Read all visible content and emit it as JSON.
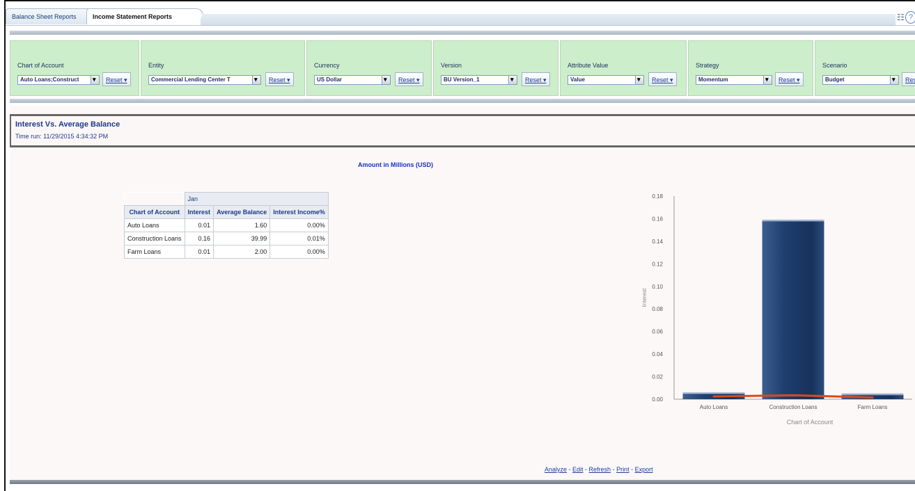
{
  "tabs": [
    {
      "label": "Balance Sheet Reports",
      "active": false
    },
    {
      "label": "Income Statement Reports",
      "active": true
    }
  ],
  "prompts": [
    {
      "label": "Chart of Account",
      "value": "Auto Loans;Construct",
      "reset": "Reset ▾"
    },
    {
      "label": "Entity",
      "value": "Commercial Lending Center T",
      "reset": "Reset ▾"
    },
    {
      "label": "Currency",
      "value": "US Dollar",
      "reset": "Reset ▾"
    },
    {
      "label": "Version",
      "value": "BU Version_1",
      "reset": "Reset ▾"
    },
    {
      "label": "Attribute Value",
      "value": "Value",
      "reset": "Reset ▾"
    },
    {
      "label": "Strategy",
      "value": "Momentum",
      "reset": "Reset ▾"
    },
    {
      "label": "Scenario",
      "value": "Budget",
      "reset": "Res"
    }
  ],
  "report": {
    "title": "Interest Vs. Average Balance",
    "time_run": "Time run: 11/29/2015 4:34:32 PM",
    "units": "Amount in Millions (USD)"
  },
  "table": {
    "period": "Jan",
    "headers": [
      "Chart of Account",
      "Interest",
      "Average Balance",
      "Interest Income%"
    ],
    "rows": [
      [
        "Auto Loans",
        "0.01",
        "1.60",
        "0.00%"
      ],
      [
        "Construction Loans",
        "0.16",
        "39.99",
        "0.01%"
      ],
      [
        "Farm Loans",
        "0.01",
        "2.00",
        "0.00%"
      ]
    ]
  },
  "chart_data": {
    "type": "bar",
    "categories": [
      "Auto Loans",
      "Construction Loans",
      "Farm Loans"
    ],
    "series": [
      {
        "values": [
          0.005,
          0.158,
          0.004
        ],
        "kind": "bar",
        "color": "#1f3f6e"
      },
      {
        "values": [
          0.0025,
          0.0035,
          0.0015
        ],
        "kind": "line",
        "color": "#d84a1b"
      }
    ],
    "xlabel": "Chart of Account",
    "ylabel": "Interest",
    "ylim": [
      0,
      0.18
    ],
    "yticks": [
      "0.00",
      "0.02",
      "0.04",
      "0.06",
      "0.08",
      "0.10",
      "0.12",
      "0.14",
      "0.16",
      "0.18"
    ]
  },
  "footer_links": [
    "Analyze",
    "Edit",
    "Refresh",
    "Print",
    "Export"
  ]
}
